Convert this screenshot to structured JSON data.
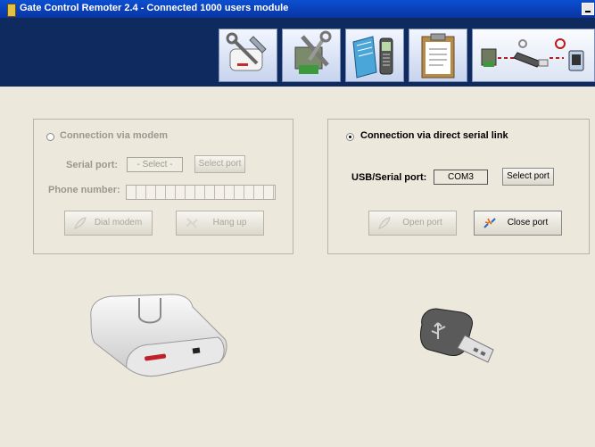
{
  "window": {
    "title": "Gate Control Remoter 2.4 - Connected 1000 users module"
  },
  "toolbar": {
    "buttons": [
      {
        "icon": "modem-tools-icon"
      },
      {
        "icon": "module-settings-icon"
      },
      {
        "icon": "phone-book-icon"
      },
      {
        "icon": "clipboard-list-icon"
      },
      {
        "icon": "connection-status-icon"
      }
    ]
  },
  "modem_panel": {
    "radio_label": "Connection via modem",
    "selected": false,
    "serial_port_label": "Serial port:",
    "serial_port_value": "- Select -",
    "select_port_button": "Select port",
    "phone_number_label": "Phone number:",
    "phone_number_value": "",
    "dial_button": "Dial modem",
    "hangup_button": "Hang up"
  },
  "serial_panel": {
    "radio_label": "Connection via direct serial link",
    "selected": true,
    "usb_serial_label": "USB/Serial port:",
    "usb_serial_value": "COM3",
    "select_port_button": "Select port",
    "open_port_button": "Open port",
    "close_port_button": "Close port"
  },
  "colors": {
    "titlebar": "#0a3fb5",
    "header": "#0e2a5e",
    "main_bg": "#ece8db",
    "disabled_text": "#9a988f"
  }
}
